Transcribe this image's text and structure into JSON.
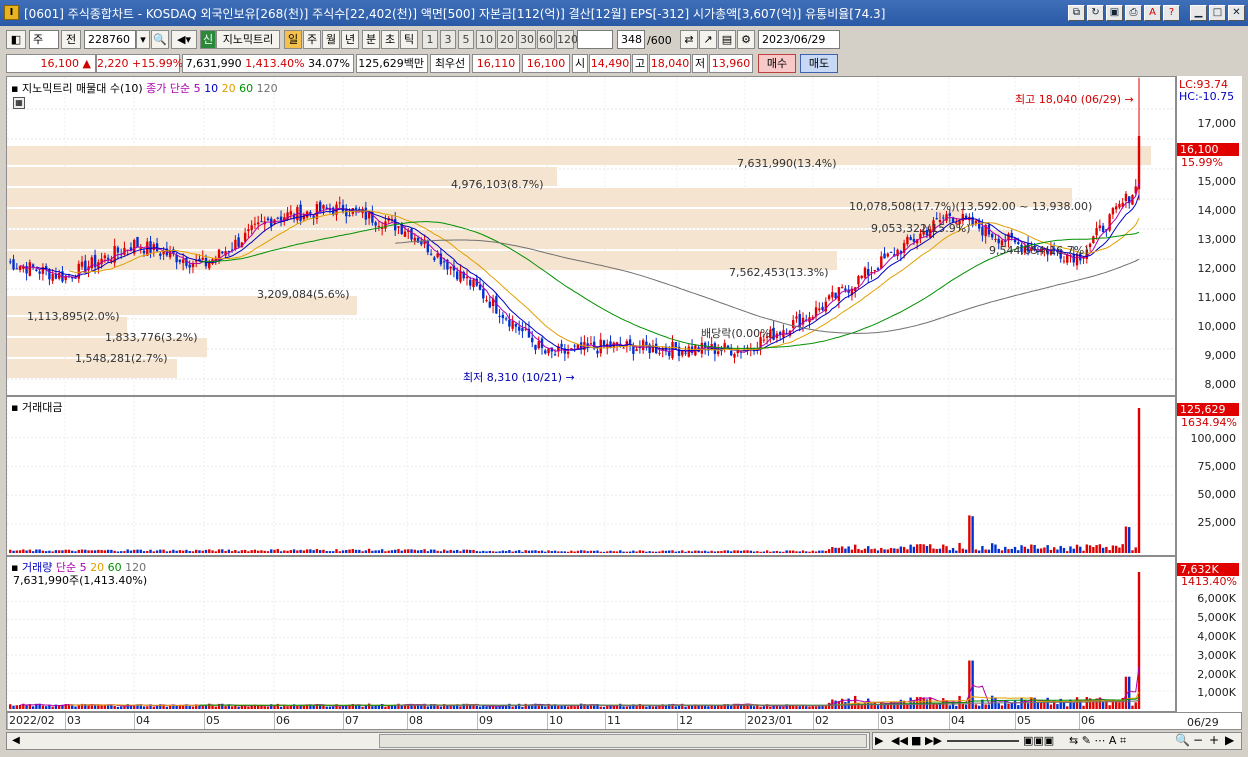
{
  "window": {
    "title": "[0601] 주식종합차트 - KOSDAQ 외국인보유[268(천)] 주식수[22,402(천)] 액면[500] 자본금[112(억)] 결산[12월] EPS[-312] 시가총액[3,607(억)] 유통비율[74.3]",
    "app_icon": "I"
  },
  "toolbar": {
    "type_select": "주",
    "prev_label": "전",
    "code": "228760",
    "indicator_btn": "지노믹트리",
    "indicator_prefix": "신",
    "periods": [
      "일",
      "주",
      "월",
      "년",
      "분",
      "초",
      "틱"
    ],
    "intervals": [
      "1",
      "3",
      "5",
      "10",
      "20",
      "30",
      "60",
      "120"
    ],
    "count": "348",
    "count_total": "/600",
    "date": "2023/06/29"
  },
  "quote": {
    "price": "16,100",
    "arrow": "▲",
    "change": "2,220",
    "change_pct": "+15.99%",
    "volume": "7,631,990",
    "volume_ratio": "1,413.40%",
    "turnover": "34.07%",
    "amount": "125,629백만",
    "bid_label": "최우선",
    "bid": "16,110",
    "ask": "16,100",
    "open_label": "시",
    "open": "14,490",
    "high_label": "고",
    "high": "18,040",
    "low_label": "저",
    "low": "13,960",
    "buy_btn": "매수",
    "sell_btn": "매도"
  },
  "price_panel": {
    "legend_name": "지노믹트리 매물대 수(10)",
    "ma_legend": "종가 단순",
    "ma_periods": [
      "5",
      "10",
      "20",
      "60",
      "120"
    ],
    "ma_colors": [
      "#b000b0",
      "#0000c0",
      "#e0a000",
      "#009000",
      "#707070"
    ],
    "lc_label": "LC:93.74",
    "hc_label": "HC:-10.75",
    "price_tag": "16,100",
    "price_tag_pct": "15.99%",
    "y_ticks": [
      "17,000",
      "16,000",
      "15,000",
      "14,000",
      "13,000",
      "12,000",
      "11,000",
      "10,000",
      "9,000",
      "8,000"
    ],
    "high_note": "최고 18,040 (06/29) →",
    "low_note": "최저 8,310 (10/21) →",
    "dividend_note": "배당락(0.00%)",
    "volume_profile": [
      {
        "label": "1,548,281(2.7%)"
      },
      {
        "label": "1,833,776(3.2%)"
      },
      {
        "label": "1,113,895(2.0%)"
      },
      {
        "label": "3,209,084(5.6%)"
      },
      {
        "label": "7,562,453(13.3%)"
      },
      {
        "label": "9,544,654(16.7%)"
      },
      {
        "label": "9,053,322(15.9%)"
      },
      {
        "label": "10,078,508(17.7%)"
      },
      {
        "label": "4,976,103(8.7%)"
      },
      {
        "label": "7,631,990(13.4%)"
      }
    ],
    "range_note": "(13,592.00 ~ 13,938.00)"
  },
  "amount_panel": {
    "title": "거래대금",
    "tag": "125,629",
    "tag_pct": "1634.94%",
    "y_ticks": [
      "100,000",
      "75,000",
      "50,000",
      "25,000"
    ]
  },
  "volume_panel": {
    "title": "거래량",
    "ma_legend": "단순",
    "ma_periods": [
      "5",
      "20",
      "60",
      "120"
    ],
    "value_line": "7,631,990주(1,413.40%)",
    "tag": "7,632K",
    "tag_pct": "1413.40%",
    "y_ticks": [
      "6,000K",
      "5,000K",
      "4,000K",
      "3,000K",
      "2,000K",
      "1,000K"
    ]
  },
  "x_axis": {
    "labels": [
      "2022/02",
      "03",
      "04",
      "05",
      "06",
      "07",
      "08",
      "09",
      "10",
      "11",
      "12",
      "2023/01",
      "02",
      "03",
      "04",
      "05",
      "06"
    ],
    "end_label": "06/29"
  },
  "chart_data": {
    "type": "candlestick",
    "title": "지노믹트리",
    "months": [
      "2022/02",
      "03",
      "04",
      "05",
      "06",
      "07",
      "08",
      "09",
      "10",
      "11",
      "12",
      "2023/01",
      "02",
      "03",
      "04",
      "05",
      "06"
    ],
    "monthly_close_approx": [
      11900,
      11400,
      12500,
      11800,
      13400,
      13700,
      13000,
      11000,
      8800,
      9100,
      9000,
      9000,
      10200,
      11800,
      13500,
      12500,
      12100
    ],
    "last_close": 16100,
    "period_high": 18040,
    "period_low": 8310,
    "ylim": [
      7800,
      17800
    ]
  }
}
